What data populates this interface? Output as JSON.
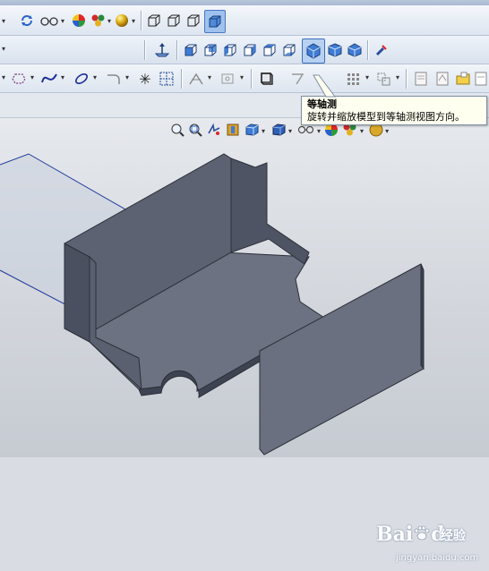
{
  "tooltip": {
    "title": "等轴测",
    "description": "旋转并缩放模型到等轴测视图方向。"
  },
  "toolbar_row1": {
    "icons": [
      "sync-icon",
      "glasses-icon",
      "appearance-sphere-icon",
      "scene-icon",
      "lighting-sphere-icon",
      "view-cube-outline-icon",
      "view-cube-outline-icon",
      "view-cube-outline-icon",
      "view-cube-selected-icon"
    ]
  },
  "standard_views": {
    "icons": [
      "normal-to-icon",
      "front-view-icon",
      "back-view-icon",
      "left-view-icon",
      "right-view-icon",
      "top-view-icon",
      "bottom-view-icon",
      "isometric-view-icon",
      "trimetric-view-icon",
      "dimetric-view-icon",
      "link-views-icon"
    ],
    "active": "isometric-view-icon"
  },
  "sketch_toolbar": {
    "icons": [
      "polygon-icon",
      "spline-icon",
      "ellipse-icon",
      "fillet-icon",
      "point-icon",
      "grid-icon",
      "trim-icon",
      "offset-icon",
      "convert-entities-icon",
      "mirror-icon",
      "linear-pattern-icon",
      "move-entities-icon",
      "note-icon",
      "table-icon",
      "folder-icon",
      "sheet-icon"
    ]
  },
  "heads_up_toolbar": {
    "icons": [
      "zoom-to-fit-icon",
      "zoom-area-icon",
      "previous-view-icon",
      "section-view-icon",
      "view-orientation-icon",
      "display-style-icon",
      "hide-show-icon",
      "edit-appearance-icon",
      "apply-scene-icon",
      "view-settings-icon"
    ]
  },
  "watermark": {
    "brand": "Bai",
    "brand_suffix": "du",
    "brand_cn": "经验",
    "site": "jingyan.baidu.com"
  },
  "colors": {
    "part_face": "#5c6272",
    "part_face_light": "#6c7282",
    "part_edge": "#2c2f38",
    "sketch_line": "#1f3a9a",
    "sketch_fill": "#c8d0dc",
    "tooltip_bg": "#fffff0"
  }
}
